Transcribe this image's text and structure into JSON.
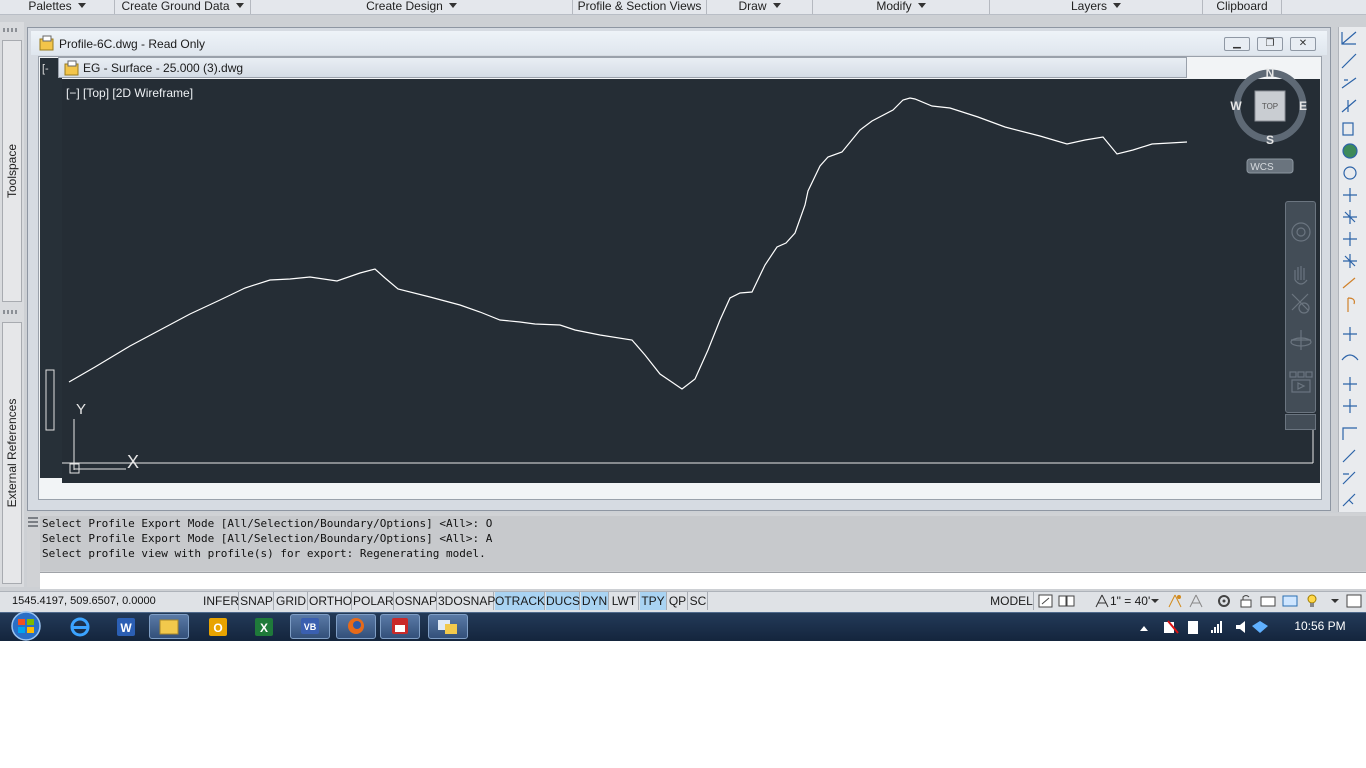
{
  "ribbon": {
    "panels": [
      {
        "label": "Palettes",
        "dropdown": true
      },
      {
        "label": "Create Ground Data",
        "dropdown": true
      },
      {
        "label": "Create Design",
        "dropdown": true
      },
      {
        "label": "Profile & Section Views",
        "dropdown": false
      },
      {
        "label": "Draw",
        "dropdown": true
      },
      {
        "label": "Modify",
        "dropdown": true
      },
      {
        "label": "Layers",
        "dropdown": true
      },
      {
        "label": "Clipboard",
        "dropdown": false
      }
    ]
  },
  "left_palette": {
    "tabs": [
      "Toolspace",
      "External References"
    ]
  },
  "drawing_window": {
    "title": "Profile-6C.dwg - Read Only",
    "subwindow_title": "EG - Surface - 25.000 (3).dwg",
    "viewport_label": "[−] [Top] [2D Wireframe]",
    "buttons": {
      "minimize": "minimize-button",
      "restore": "restore-button",
      "close": "close-button"
    }
  },
  "viewcube": {
    "north": "N",
    "south": "S",
    "east": "E",
    "west": "W",
    "face": "TOP",
    "wcs": "WCS"
  },
  "ucs": {
    "x_label": "X",
    "y_label": "Y"
  },
  "command": {
    "history": [
      "Select Profile Export Mode [All/Selection/Boundary/Options] <All>: O",
      "Select Profile Export Mode [All/Selection/Boundary/Options] <All>: A",
      "Select profile view with profile(s) for export: Regenerating model."
    ],
    "input_value": ""
  },
  "status_bar": {
    "coordinates": "1545.4197, 509.6507, 0.0000",
    "toggles": [
      {
        "label": "INFER",
        "on": false
      },
      {
        "label": "SNAP",
        "on": false
      },
      {
        "label": "GRID",
        "on": false
      },
      {
        "label": "ORTHO",
        "on": false
      },
      {
        "label": "POLAR",
        "on": false
      },
      {
        "label": "OSNAP",
        "on": false
      },
      {
        "label": "3DOSNAP",
        "on": false
      },
      {
        "label": "OTRACK",
        "on": true
      },
      {
        "label": "DUCS",
        "on": true
      },
      {
        "label": "DYN",
        "on": true
      },
      {
        "label": "LWT",
        "on": false
      },
      {
        "label": "TPY",
        "on": true
      },
      {
        "label": "QP",
        "on": false
      },
      {
        "label": "SC",
        "on": false
      }
    ],
    "space": "MODEL",
    "annotation_scale": "1\" = 40'"
  },
  "taskbar": {
    "apps": [
      "start-orb-icon",
      "internet-explorer-icon",
      "word-icon",
      "file-explorer-icon",
      "outlook-icon",
      "excel-icon",
      "visio-icon",
      "firefox-icon",
      "civil3d-icon",
      "chat-icon"
    ],
    "clock": "10:56 PM"
  },
  "colors": {
    "viewport_bg": "#252d35",
    "profile_line": "#ffffff",
    "toggle_on": "#a9d3f2",
    "taskbar": "#1a2e4a"
  }
}
